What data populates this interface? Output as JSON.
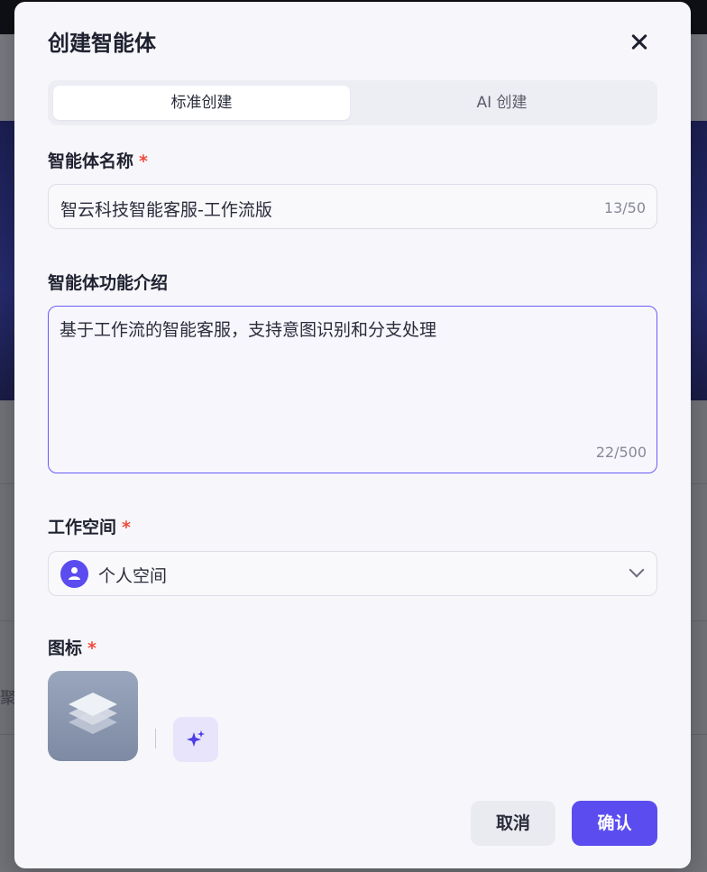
{
  "dialog": {
    "title": "创建智能体",
    "tabs": [
      {
        "label": "标准创建",
        "active": true
      },
      {
        "label": "AI 创建",
        "active": false
      }
    ]
  },
  "form": {
    "name": {
      "label": "智能体名称",
      "required_mark": "*",
      "value": "智云科技智能客服-工作流版",
      "counter": "13/50"
    },
    "description": {
      "label": "智能体功能介绍",
      "value": "基于工作流的智能客服，支持意图识别和分支处理",
      "counter": "22/500"
    },
    "workspace": {
      "label": "工作空间",
      "required_mark": "*",
      "value": "个人空间",
      "avatar_icon": "user-icon"
    },
    "icon": {
      "label": "图标",
      "required_mark": "*",
      "selected_icon": "layers-icon",
      "generate_icon": "sparkle-icon"
    }
  },
  "footer": {
    "cancel_label": "取消",
    "confirm_label": "确认"
  },
  "background": {
    "partial_char": "聚"
  },
  "colors": {
    "accent": "#5b4cf0",
    "required": "#f04b3c",
    "focus_border": "#6a5cf6"
  }
}
